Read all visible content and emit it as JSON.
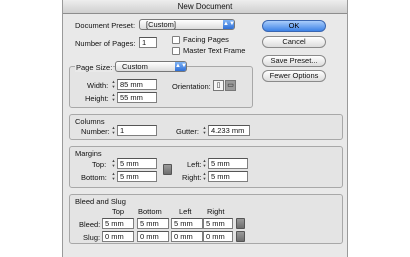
{
  "window": {
    "title": "New Document"
  },
  "preset": {
    "label": "Document Preset:",
    "value": "[Custom]"
  },
  "pages": {
    "label": "Number of Pages:",
    "value": "1"
  },
  "options": {
    "facing_pages": {
      "label": "Facing Pages",
      "checked": false
    },
    "master_text_frame": {
      "label": "Master Text Frame",
      "checked": false
    }
  },
  "buttons": {
    "ok": "OK",
    "cancel": "Cancel",
    "save_preset": "Save Preset...",
    "fewer_options": "Fewer Options"
  },
  "page_size": {
    "label": "Page Size:",
    "value": "Custom",
    "width_label": "Width:",
    "width": "85 mm",
    "height_label": "Height:",
    "height": "55 mm",
    "orientation_label": "Orientation:"
  },
  "columns": {
    "title": "Columns",
    "number_label": "Number:",
    "number": "1",
    "gutter_label": "Gutter:",
    "gutter": "4.233 mm"
  },
  "margins": {
    "title": "Margins",
    "top_label": "Top:",
    "top": "5 mm",
    "bottom_label": "Bottom:",
    "bottom": "5 mm",
    "left_label": "Left:",
    "left": "5 mm",
    "right_label": "Right:",
    "right": "5 mm"
  },
  "bleed_slug": {
    "title": "Bleed and Slug",
    "headers": [
      "Top",
      "Bottom",
      "Left",
      "Right"
    ],
    "bleed_label": "Bleed:",
    "bleed": [
      "5 mm",
      "5 mm",
      "5 mm",
      "5 mm"
    ],
    "slug_label": "Slug:",
    "slug": [
      "0 mm",
      "0 mm",
      "0 mm",
      "0 mm"
    ]
  }
}
